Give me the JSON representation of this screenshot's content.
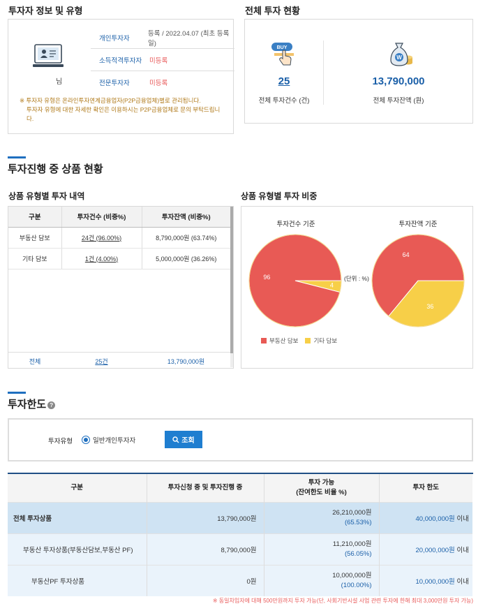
{
  "investor_section": {
    "title": "투자자 정보 및 유형",
    "user_suffix": "님",
    "rows": [
      {
        "label": "개인투자자",
        "value": "등록 / 2022.04.07 (최초 등록일)",
        "status": "normal"
      },
      {
        "label": "소득적격투자자",
        "value": "미등록",
        "status": "unregistered"
      },
      {
        "label": "전문투자자",
        "value": "미등록",
        "status": "unregistered"
      }
    ],
    "notice_line1": "※ 투자자 유형은 온라인투자연계금융업자(P2P금융업체)별로 관리됩니다.",
    "notice_line2": "투자자 유형에 대한 자세한 확인은 이용하시는 P2P금융업체로 문의 부탁드립니",
    "notice_line3": "다."
  },
  "total_section": {
    "title": "전체 투자 현황",
    "buy_badge": "BUY",
    "count_value": "25",
    "count_label": "전체 투자건수 (건)",
    "balance_value": "13,790,000",
    "balance_label": "전체 투자잔액 (원)",
    "won_symbol": "W"
  },
  "progress_section": {
    "title": "투자진행 중 상품 현황",
    "table_title": "상품 유형별 투자 내역",
    "chart_title": "상품 유형별 투자 비중",
    "columns": [
      "구분",
      "투자건수 (비중%)",
      "투자잔액 (비중%)"
    ],
    "rows": [
      {
        "type": "부동산 담보",
        "count": "24건 (96.00%)",
        "balance": "8,790,000원 (63.74%)"
      },
      {
        "type": "기타 담보",
        "count": "1건 (4.00%)",
        "balance": "5,000,000원 (36.26%)"
      }
    ],
    "total": {
      "type": "전체",
      "count": "25건",
      "balance": "13,790,000원"
    }
  },
  "chart_data": [
    {
      "type": "pie",
      "title": "투자건수 기준",
      "categories": [
        "부동산 담보",
        "기타 담보"
      ],
      "values": [
        96,
        4
      ],
      "colors": [
        "#e85a55",
        "#f7cf48"
      ],
      "unit_label": "(단위 : %)"
    },
    {
      "type": "pie",
      "title": "투자잔액 기준",
      "categories": [
        "부동산 담보",
        "기타 담보"
      ],
      "values": [
        64,
        36
      ],
      "colors": [
        "#e85a55",
        "#f7cf48"
      ]
    }
  ],
  "chart_legend": [
    "부동산 담보",
    "기타 담보"
  ],
  "limit_section": {
    "title": "투자한도",
    "help_icon": "?",
    "filter_label": "투자유형",
    "radio_label": "일반개인투자자",
    "search_button": "조회",
    "columns": [
      "구분",
      "투자신청 중 및 투자진행 중",
      "투자 가능",
      "(잔여한도 비율 %)",
      "투자 한도"
    ],
    "rows": [
      {
        "name": "전체 투자상품",
        "applied": "13,790,000원",
        "available": "26,210,000원",
        "ratio": "(65.53%)",
        "limit": "40,000,000원",
        "limit_suffix": "이내"
      },
      {
        "name": "부동산 투자상품(부동산담보,부동산 PF)",
        "applied": "8,790,000원",
        "available": "11,210,000원",
        "ratio": "(56.05%)",
        "limit": "20,000,000원",
        "limit_suffix": "이내"
      },
      {
        "name": "부동산PF 투자상품",
        "applied": "0원",
        "available": "10,000,000원",
        "ratio": "(100.00%)",
        "limit": "10,000,000원",
        "limit_suffix": "이내"
      }
    ],
    "footnote": "※ 동일차입자에 대해 500만원까지 투자 가능(단, 사회기반시설 사업 관련 투자에 한해 최대 3,000만원 투자 가능)"
  }
}
